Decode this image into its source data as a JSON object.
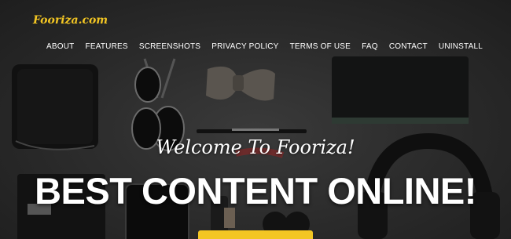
{
  "brand": {
    "logo_text": "Fooriza.com",
    "accent_color": "#f3c623"
  },
  "nav": {
    "items": [
      {
        "label": "ABOUT"
      },
      {
        "label": "FEATURES"
      },
      {
        "label": "SCREENSHOTS"
      },
      {
        "label": "PRIVACY POLICY"
      },
      {
        "label": "TERMS OF USE"
      },
      {
        "label": "FAQ"
      },
      {
        "label": "CONTACT"
      },
      {
        "label": "UNINSTALL"
      }
    ]
  },
  "hero": {
    "welcome": "Welcome To Fooriza!",
    "headline": "BEST CONTENT ONLINE!",
    "background_icons": [
      "wallet-icon",
      "sunglasses-icon",
      "bow-tie-icon",
      "notebook-icon",
      "pen-icon",
      "headphones-icon",
      "phone-icon",
      "card-wallet-icon"
    ]
  }
}
